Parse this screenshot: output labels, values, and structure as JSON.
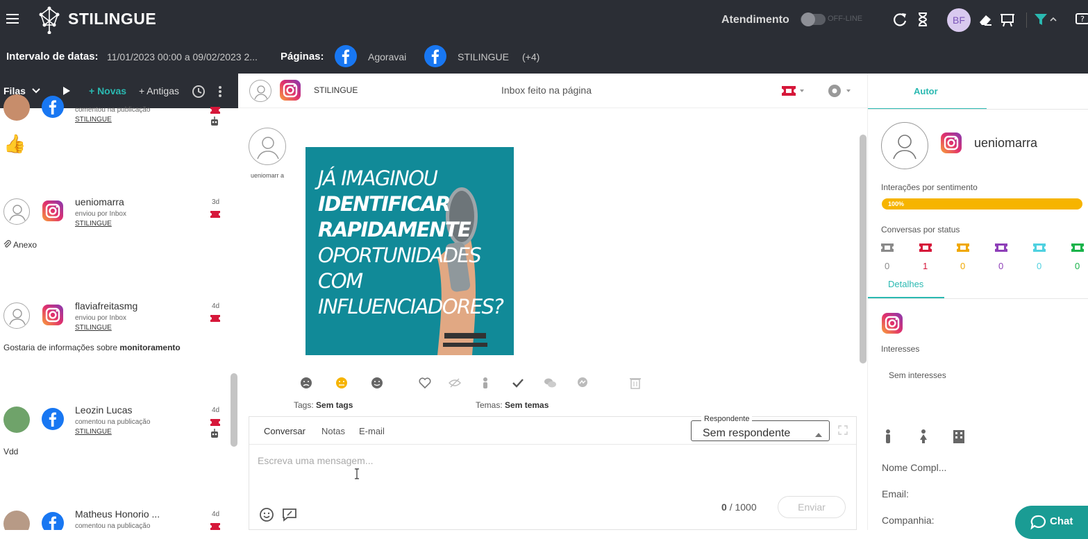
{
  "header": {
    "brand": "STILINGUE",
    "atendimento_label": "Atendimento",
    "status_label": "OFF-LINE",
    "user_initials": "BF"
  },
  "filters": {
    "date_label": "Intervalo de datas:",
    "date_value": "11/01/2023 00:00 a 09/02/2023 2...",
    "pages_label": "Páginas:",
    "pages": [
      "Agoravai",
      "STILINGUE"
    ],
    "more_pages": "(+4)"
  },
  "queue": {
    "title": "Filas",
    "new_label": "+ Novas",
    "old_label": "+ Antigas",
    "conversations": [
      {
        "network": "facebook",
        "name": "",
        "sub": "comentou na publicação",
        "page": "STILINGUE",
        "ago": "",
        "message": "👍"
      },
      {
        "network": "instagram",
        "name": "ueniomarra",
        "sub": "enviou por Inbox",
        "page": "STILINGUE",
        "ago": "3d",
        "message": "Anexo"
      },
      {
        "network": "instagram",
        "name": "flaviafreitasmg",
        "sub": "enviou por Inbox",
        "page": "STILINGUE",
        "ago": "4d",
        "message": "Gostaria de informações sobre ",
        "message_bold": "monitoramento"
      },
      {
        "network": "facebook",
        "name": "Leozin Lucas",
        "sub": "comentou na publicação",
        "page": "STILINGUE",
        "ago": "4d",
        "message": "Vdd"
      },
      {
        "network": "facebook",
        "name": "Matheus Honorio ...",
        "sub": "comentou na publicação",
        "page": "STILINGUE",
        "ago": "4d",
        "message": ""
      }
    ]
  },
  "conversation": {
    "page_name": "STILINGUE",
    "context": "Inbox feito na página",
    "author": "ueniomarr a",
    "post_lines": [
      "JÁ IMAGINOU",
      "IDENTIFICAR",
      "RAPIDAMENTE",
      "OPORTUNIDADES",
      "COM",
      "INFLUENCIADORES?"
    ],
    "tags_label": "Tags:",
    "tags_value": "Sem tags",
    "themes_label": "Temas:",
    "themes_value": "Sem temas",
    "composer": {
      "tabs": [
        "Conversar",
        "Notas",
        "E-mail"
      ],
      "responder_label": "Respondente",
      "responder_value": "Sem respondente",
      "placeholder": "Escreva uma mensagem...",
      "count_current": "0",
      "count_sep": "/",
      "count_max": "1000",
      "send_label": "Enviar"
    }
  },
  "author_panel": {
    "tab": "Autor",
    "username": "ueniomarra",
    "sentiment_label": "Interações por sentimento",
    "sentiment_percent": "100%",
    "sentiment_fraction": 1.0,
    "status_label": "Conversas por status",
    "status_counts": [
      {
        "value": "0",
        "color": "#8a8a8a"
      },
      {
        "value": "1",
        "color": "#d6173a"
      },
      {
        "value": "0",
        "color": "#f0a800"
      },
      {
        "value": "0",
        "color": "#8e3fb8"
      },
      {
        "value": "0",
        "color": "#4fd1e0"
      },
      {
        "value": "0",
        "color": "#19b34a"
      }
    ],
    "details_tab": "Detalhes",
    "interests_label": "Interesses",
    "interests_value": "Sem interesses",
    "fields": [
      "Nome Compl...",
      "Email:",
      "Companhia:"
    ]
  },
  "chat_button": "Chat",
  "colors": {
    "accent": "#2ab9b1",
    "topbar": "#2b2e35",
    "facebook": "#1877f2",
    "warning": "#f6b400"
  }
}
